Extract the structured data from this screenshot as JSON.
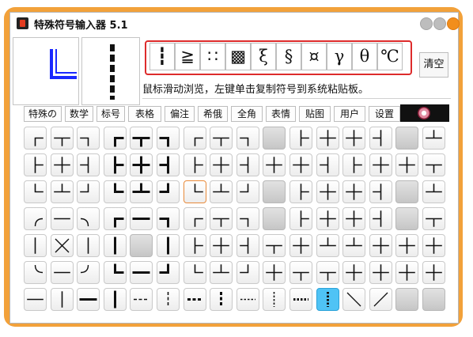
{
  "window": {
    "title": "特殊符号输入器 5.1",
    "accent_color": "#f2a13a",
    "buttons": [
      "minimize-button",
      "maximize-button",
      "close-button"
    ]
  },
  "symbols": [
    "┇",
    "≧",
    "∷",
    "▩",
    "ξ",
    "§",
    "¤",
    "γ",
    "θ",
    "℃"
  ],
  "clear_label": "清空",
  "hint": "鼠标滑动浏览，左键单击复制符号到系统粘贴板。",
  "tabs": [
    "特殊の",
    "数学",
    "标号",
    "表格",
    "偏注",
    "希俄",
    "全角",
    "表情",
    "贴图",
    "用户",
    "设置"
  ],
  "grid_rows": [
    [
      "┌",
      "┬",
      "┐",
      "┏",
      "┳",
      "┓",
      "┌",
      "┬",
      "┐",
      "",
      "├",
      "┼",
      "┼",
      "┤",
      "",
      "┴"
    ],
    [
      "├",
      "┼",
      "┤",
      "┣",
      "╋",
      "┫",
      "├",
      "┼",
      "┤",
      "┼",
      "┼",
      "┤",
      "├",
      "┼",
      "┼",
      "┬"
    ],
    [
      "└",
      "┴",
      "┘",
      "┗",
      "┻",
      "┛",
      "└",
      "┴",
      "┘",
      "",
      "├",
      "┼",
      "┼",
      "┤",
      "",
      "┴"
    ],
    [
      "╭",
      "─",
      "╮",
      "┏",
      "━",
      "┓",
      "┌",
      "┬",
      "┐",
      "",
      "├",
      "┼",
      "┼",
      "┤",
      "",
      "┬"
    ],
    [
      "│",
      "╳",
      "│",
      "┃",
      "",
      "┃",
      "├",
      "┼",
      "┤",
      "┬",
      "┼",
      "┴",
      "┴",
      "┼",
      "┼",
      "┼"
    ],
    [
      "╰",
      "─",
      "╯",
      "┗",
      "━",
      "┛",
      "└",
      "┴",
      "┘",
      "┼",
      "┬",
      "┬",
      "┼",
      "┼",
      "┼",
      "┼"
    ],
    [
      "─",
      "│",
      "━",
      "┃",
      "┄",
      "┆",
      "┅",
      "┇",
      "┈",
      "┊",
      "┉",
      "┋",
      "╲",
      "╱",
      "",
      ""
    ]
  ]
}
